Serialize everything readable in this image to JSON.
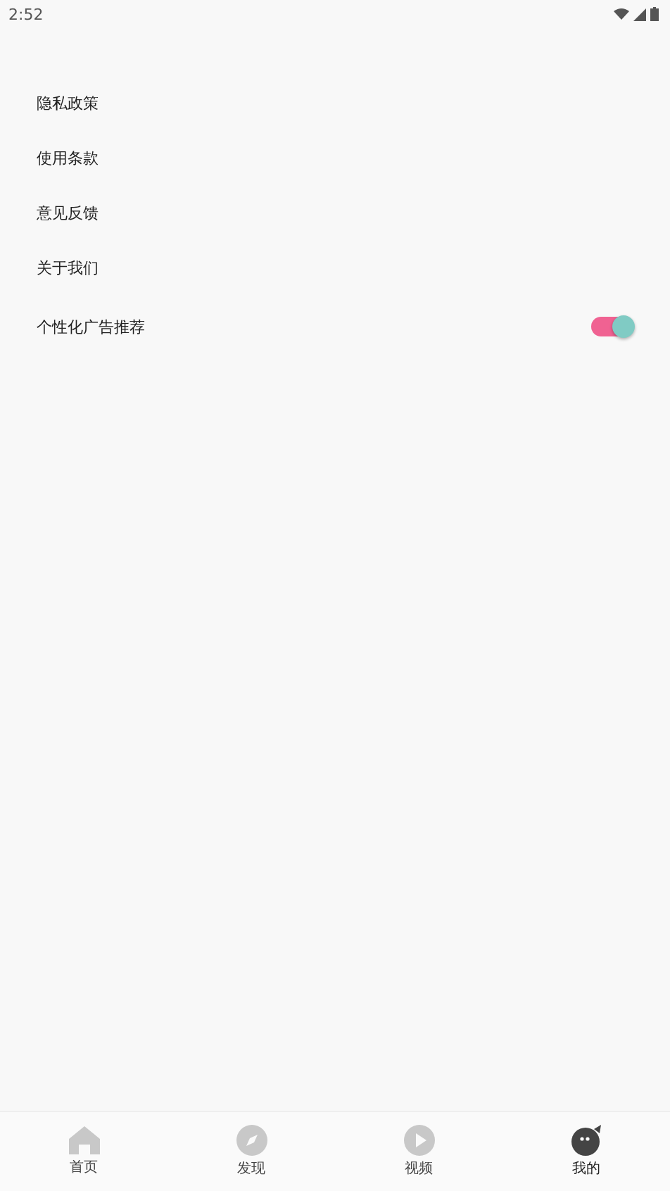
{
  "status_bar": {
    "time": "2:52"
  },
  "settings": [
    {
      "kind": "link",
      "label": "隐私政策"
    },
    {
      "kind": "link",
      "label": "使用条款"
    },
    {
      "kind": "link",
      "label": "意见反馈"
    },
    {
      "kind": "link",
      "label": "关于我们"
    },
    {
      "kind": "toggle",
      "label": "个性化广告推荐",
      "on": true
    }
  ],
  "bottom_nav": [
    {
      "kind": "home",
      "label": "首页",
      "selected": false
    },
    {
      "kind": "discover",
      "label": "发现",
      "selected": false
    },
    {
      "kind": "video",
      "label": "视频",
      "selected": false
    },
    {
      "kind": "profile",
      "label": "我的",
      "selected": true
    }
  ]
}
